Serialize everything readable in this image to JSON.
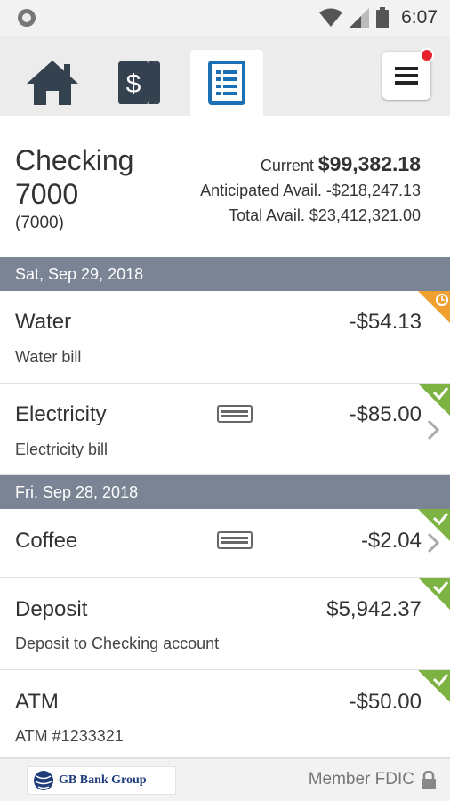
{
  "status_bar": {
    "time": "6:07"
  },
  "account": {
    "name": "Checking 7000",
    "number": "(7000)",
    "current_label": "Current",
    "current_value": "$99,382.18",
    "anticipated": "Anticipated Avail. -$218,247.13",
    "total": "Total Avail. $23,412,321.00"
  },
  "groups": [
    {
      "date": "Sat, Sep 29, 2018",
      "items": [
        {
          "name": "Water",
          "description": "Water bill",
          "amount": "-$54.13",
          "status": "pending"
        },
        {
          "name": "Electricity",
          "description": "Electricity bill",
          "amount": "-$85.00",
          "status": "cleared"
        }
      ]
    },
    {
      "date": "Fri, Sep 28, 2018",
      "items": [
        {
          "name": "Coffee",
          "description": "",
          "amount": "-$2.04",
          "status": "cleared"
        },
        {
          "name": "Deposit",
          "description": "Deposit to Checking account",
          "amount": "$5,942.37",
          "status": "cleared"
        },
        {
          "name": "ATM",
          "description": "ATM #1233321",
          "amount": "-$50.00",
          "status": "cleared"
        }
      ]
    }
  ],
  "footer": {
    "logo_text": "GB Bank Group",
    "member": "Member FDIC"
  },
  "colors": {
    "accent": "#1a6fb5",
    "header_bg": "#7a8494",
    "cleared": "#7cb342",
    "pending": "#f0a030",
    "badge": "#e8202a"
  },
  "icons": [
    "home-icon",
    "dollar-card-icon",
    "transactions-icon",
    "menu-icon",
    "card-icon",
    "chevron-right-icon",
    "check-icon",
    "clock-icon",
    "lock-icon"
  ]
}
